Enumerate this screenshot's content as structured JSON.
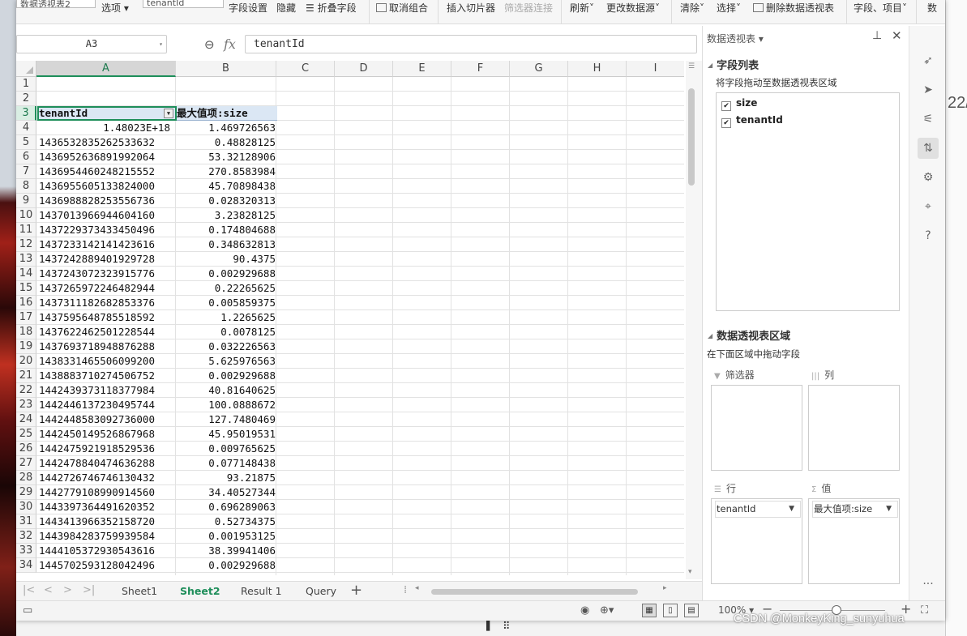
{
  "ribbon": {
    "pivot_name_box": "数据透视表2",
    "options_label": "选项",
    "active_field_box": "tenantId",
    "field_settings_label": "字段设置",
    "hide_label": "隐藏",
    "collapse_field_label": "折叠字段",
    "ungroup_label": "取消组合",
    "insert_slicer_label": "插入切片器",
    "filter_connections_label": "筛选器连接",
    "refresh_label": "刷新",
    "change_source_label": "更改数据源",
    "clear_label": "清除",
    "select_label": "选择",
    "delete_pivot_label": "删除数据透视表",
    "field_items_label": "字段、项目",
    "cut_label": "数"
  },
  "formula_bar": {
    "name_box": "A3",
    "fx_label": "fx",
    "formula": "tenantId"
  },
  "columns": [
    "A",
    "B",
    "C",
    "D",
    "E",
    "F",
    "G",
    "H",
    "I"
  ],
  "selected_cell": "A3",
  "table": {
    "header_a": "tenantId",
    "header_b": "最大值项:size",
    "rows": [
      {
        "row": "1",
        "a": "",
        "b": ""
      },
      {
        "row": "2",
        "a": "",
        "b": ""
      },
      {
        "row": "3",
        "a": "tenantId",
        "b": "最大值项:size"
      },
      {
        "row": "4",
        "a": "1.48023E+18",
        "b": "1.469726563"
      },
      {
        "row": "5",
        "a": "1436532835262533632",
        "b": "0.48828125"
      },
      {
        "row": "6",
        "a": "1436952636891992064",
        "b": "53.32128906"
      },
      {
        "row": "7",
        "a": "1436954460248215552",
        "b": "270.8583984"
      },
      {
        "row": "8",
        "a": "1436955605133824000",
        "b": "45.70898438"
      },
      {
        "row": "9",
        "a": "1436988828253556736",
        "b": "0.028320313"
      },
      {
        "row": "10",
        "a": "1437013966944604160",
        "b": "3.23828125"
      },
      {
        "row": "11",
        "a": "1437229373433450496",
        "b": "0.174804688"
      },
      {
        "row": "12",
        "a": "1437233142141423616",
        "b": "0.348632813"
      },
      {
        "row": "13",
        "a": "1437242889401929728",
        "b": "90.4375"
      },
      {
        "row": "14",
        "a": "1437243072323915776",
        "b": "0.002929688"
      },
      {
        "row": "15",
        "a": "1437265972246482944",
        "b": "0.22265625"
      },
      {
        "row": "16",
        "a": "1437311182682853376",
        "b": "0.005859375"
      },
      {
        "row": "17",
        "a": "1437595648785518592",
        "b": "1.2265625"
      },
      {
        "row": "18",
        "a": "1437622462501228544",
        "b": "0.0078125"
      },
      {
        "row": "19",
        "a": "1437693718948876288",
        "b": "0.032226563"
      },
      {
        "row": "20",
        "a": "1438331465506099200",
        "b": "5.625976563"
      },
      {
        "row": "21",
        "a": "1438883710274506752",
        "b": "0.002929688"
      },
      {
        "row": "22",
        "a": "1442439373118377984",
        "b": "40.81640625"
      },
      {
        "row": "23",
        "a": "1442446137230495744",
        "b": "100.0888672"
      },
      {
        "row": "24",
        "a": "1442448583092736000",
        "b": "127.7480469"
      },
      {
        "row": "25",
        "a": "1442450149526867968",
        "b": "45.95019531"
      },
      {
        "row": "26",
        "a": "1442475921918529536",
        "b": "0.009765625"
      },
      {
        "row": "27",
        "a": "1442478840474636288",
        "b": "0.077148438"
      },
      {
        "row": "28",
        "a": "1442726746746130432",
        "b": "93.21875"
      },
      {
        "row": "29",
        "a": "1442779108990914560",
        "b": "34.40527344"
      },
      {
        "row": "30",
        "a": "1443397364491620352",
        "b": "0.696289063"
      },
      {
        "row": "31",
        "a": "1443413966352158720",
        "b": "0.52734375"
      },
      {
        "row": "32",
        "a": "1443984283759939584",
        "b": "0.001953125"
      },
      {
        "row": "33",
        "a": "1444105372930543616",
        "b": "38.39941406"
      },
      {
        "row": "34",
        "a": "1445702593128042496",
        "b": "0.002929688"
      }
    ]
  },
  "sheet_tabs": [
    "Sheet1",
    "Sheet2",
    "Result 1",
    "Query"
  ],
  "active_sheet": "Sheet2",
  "status": {
    "zoom": "100%"
  },
  "pivot_pane": {
    "title": "数据透视表",
    "field_list_title": "字段列表",
    "field_list_hint": "将字段拖动至数据透视表区域",
    "fields": [
      {
        "name": "size",
        "checked": true
      },
      {
        "name": "tenantId",
        "checked": true
      }
    ],
    "areas_title": "数据透视表区域",
    "areas_hint": "在下面区域中拖动字段",
    "filter_label": "筛选器",
    "column_label": "列",
    "row_label": "行",
    "value_label": "值",
    "row_chip": "tenantId",
    "value_chip": "最大值项:size"
  },
  "background_fragment": "22/",
  "watermark": "CSDN @MonkeyKing_sunyuhua"
}
